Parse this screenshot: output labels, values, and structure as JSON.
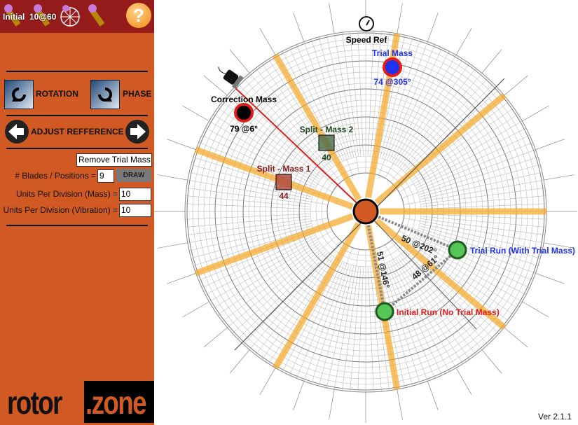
{
  "toolbar": {
    "initial_label": "Initial",
    "trial_label": "10@60",
    "help_icon": "?"
  },
  "controls": {
    "rotation": "ROTATION",
    "phase": "PHASE",
    "adjust_reference": "ADJUST REFFERENCE",
    "remove_trial_mass": "Remove Trial Mass",
    "blades_label": "# Blades / Positions =",
    "blades_value": "9",
    "draw": "DRAW",
    "mass_label": "Units Per Division (Mass) =",
    "mass_value": "10",
    "vib_label": "Units Per Division (Vibration) =",
    "vib_value": "10"
  },
  "logo": {
    "left": "rotor",
    "right": ".zone"
  },
  "plot": {
    "blades": 9,
    "speed_ref": "Speed Ref",
    "trial_mass": {
      "label": "Trial Mass",
      "value": "74 @305°",
      "color": "#2233ee"
    },
    "correction_mass": {
      "label": "Correction Mass",
      "value": "79 @6°"
    },
    "split1": {
      "label": "Split - Mass 1",
      "value": "44",
      "color": "#8b1a1a"
    },
    "split2": {
      "label": "Split - Mass 2",
      "value": "40",
      "color": "#1f4a1f"
    },
    "trial_run": {
      "label": "Trial Run (With Trial Mass)",
      "color": "#2233ee"
    },
    "initial_run": {
      "label": "Initial Run (No Trial Mass)",
      "color": "#e21b1b"
    },
    "vec_trial": "50 @202°",
    "vec_initial": "51 @146°",
    "vec_diff": "48 @61°"
  },
  "version": "Ver 2.1.1"
}
